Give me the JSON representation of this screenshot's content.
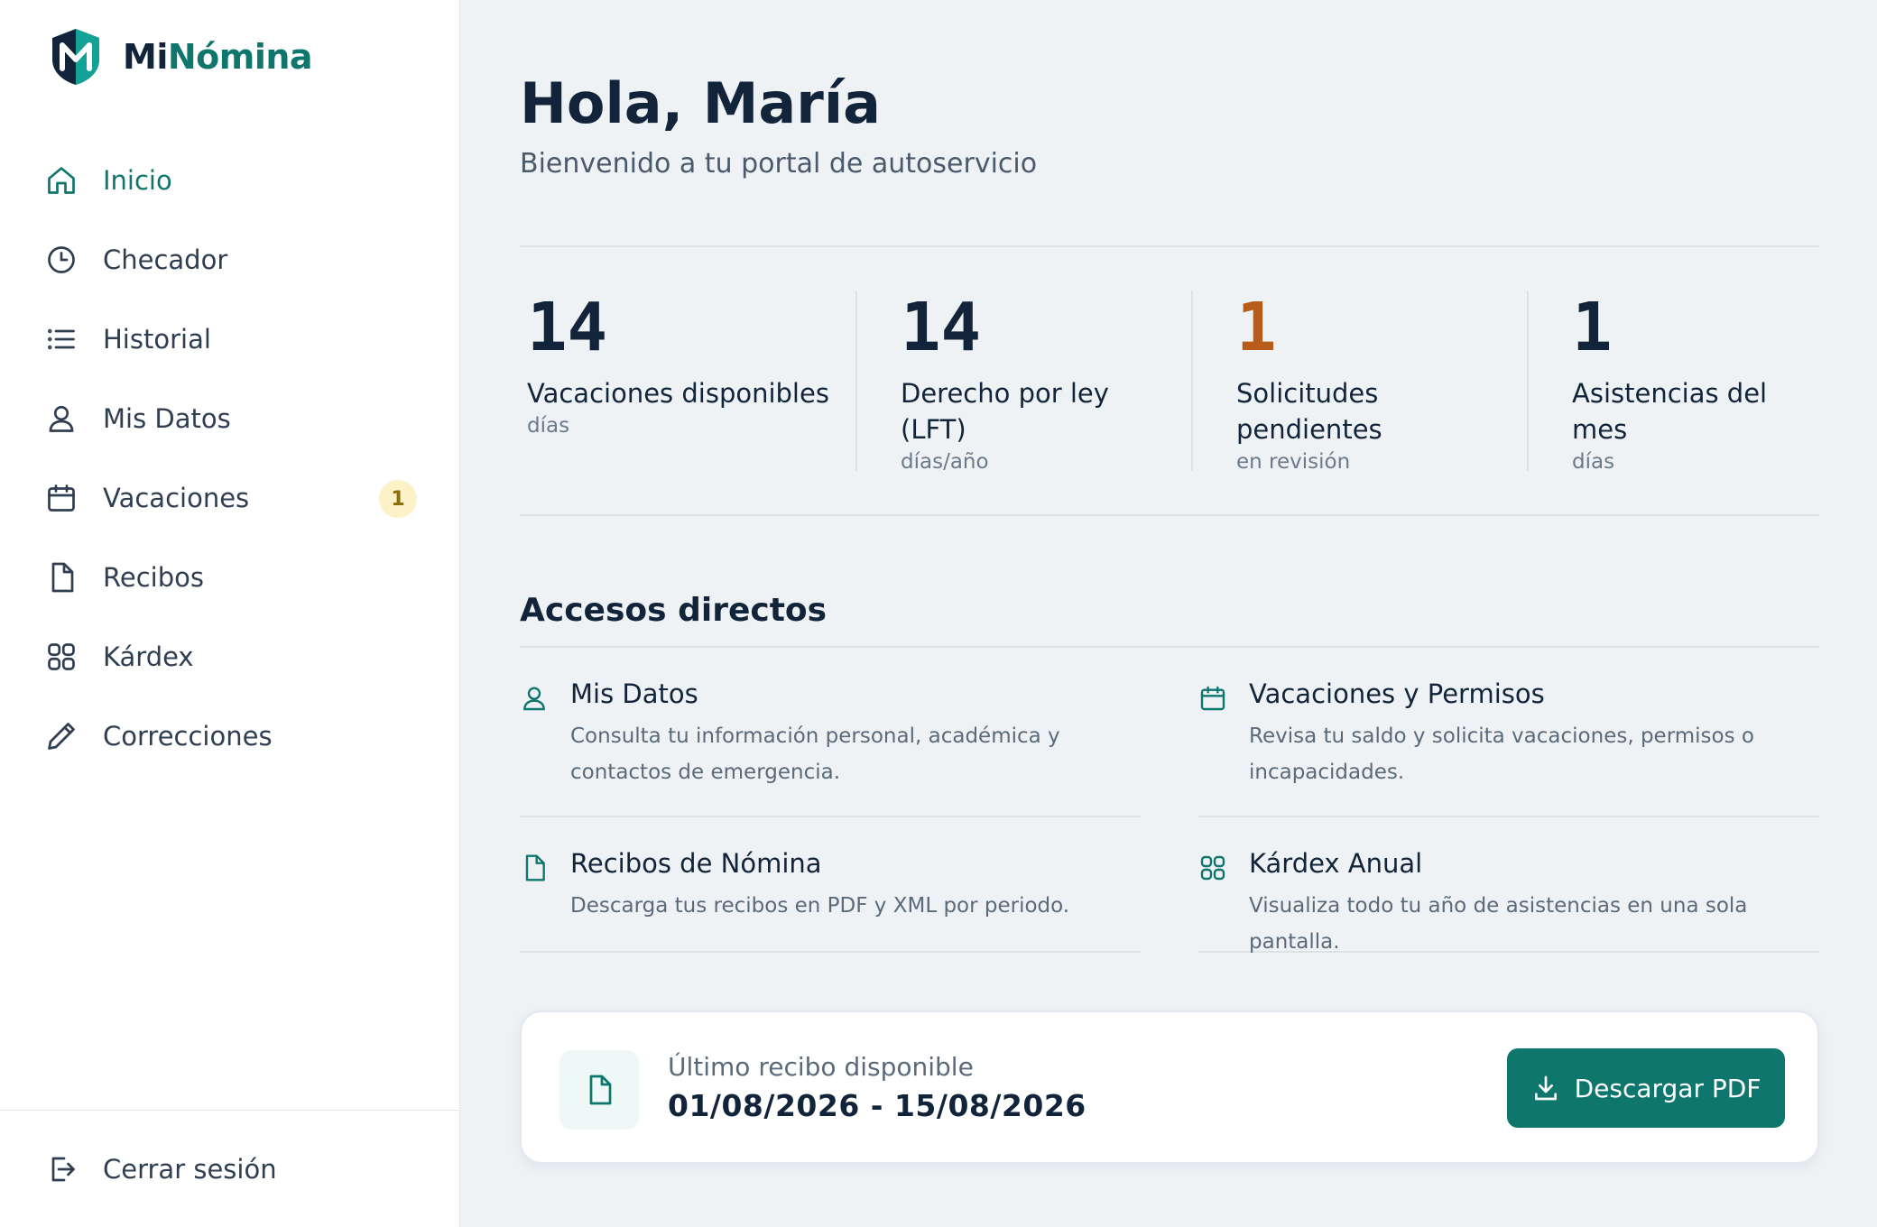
{
  "brand": {
    "name_prefix": "Mi",
    "name_accent": "Nómina",
    "accent_color": "#0f766e"
  },
  "sidebar": {
    "items": [
      {
        "label": "Inicio",
        "icon": "home-icon",
        "active": true
      },
      {
        "label": "Checador",
        "icon": "clock-icon"
      },
      {
        "label": "Historial",
        "icon": "list-icon"
      },
      {
        "label": "Mis Datos",
        "icon": "user-icon"
      },
      {
        "label": "Vacaciones",
        "icon": "calendar-icon",
        "badge": "1"
      },
      {
        "label": "Recibos",
        "icon": "document-icon"
      },
      {
        "label": "Kárdex",
        "icon": "grid-icon"
      },
      {
        "label": "Correcciones",
        "icon": "pencil-icon"
      }
    ],
    "logout_label": "Cerrar sesión"
  },
  "header": {
    "greeting": "Hola, María",
    "subtitle": "Bienvenido a tu portal de autoservicio"
  },
  "stats": [
    {
      "value": "14",
      "label": "Vacaciones disponibles",
      "unit": "días",
      "color": "#12243a"
    },
    {
      "value": "14",
      "label": "Derecho por ley (LFT)",
      "unit": "días/año",
      "color": "#12243a"
    },
    {
      "value": "1",
      "label": "Solicitudes pendientes",
      "unit": "en revisión",
      "color": "#b85c1a"
    },
    {
      "value": "1",
      "label": "Asistencias del mes",
      "unit": "días",
      "color": "#12243a"
    }
  ],
  "shortcuts": {
    "title": "Accesos directos",
    "items": [
      {
        "title": "Mis Datos",
        "description": "Consulta tu información personal, académica y contactos de emergencia.",
        "icon": "user-icon"
      },
      {
        "title": "Vacaciones y Permisos",
        "description": "Revisa tu saldo y solicita vacaciones, permisos o incapacidades.",
        "icon": "calendar-icon"
      },
      {
        "title": "Recibos de Nómina",
        "description": "Descarga tus recibos en PDF y XML por periodo.",
        "icon": "document-icon"
      },
      {
        "title": "Kárdex Anual",
        "description": "Visualiza todo tu año de asistencias en una sola pantalla.",
        "icon": "grid-icon"
      }
    ]
  },
  "receipt": {
    "label": "Último recibo disponible",
    "period": "01/08/2026 - 15/08/2026",
    "button_label": "Descargar PDF"
  }
}
